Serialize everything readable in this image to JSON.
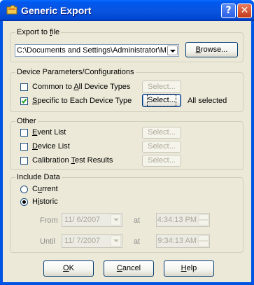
{
  "window": {
    "title": "Generic Export",
    "help_glyph": "?",
    "close_glyph": "✕",
    "title_icon": "folder-export-icon"
  },
  "export_to_file": {
    "group_title_pre": "Export to ",
    "group_title_u": "f",
    "group_title_post": "ile",
    "path_value": "C:\\Documents and Settings\\Administrator\\M",
    "browse_pre": "",
    "browse_u": "B",
    "browse_post": "rowse..."
  },
  "device_params": {
    "group_title": "Device Parameters/Configurations",
    "common": {
      "label_pre": "Common to ",
      "label_u": "A",
      "label_post": "ll Device Types",
      "checked": false,
      "select_label": "Select..."
    },
    "specific": {
      "label_pre": "",
      "label_u": "S",
      "label_post": "pecific to Each Device Type",
      "checked": true,
      "select_label": "Select...",
      "status": "All selected"
    }
  },
  "other": {
    "group_title": "Other",
    "items": [
      {
        "label_pre": "",
        "label_u": "E",
        "label_post": "vent List",
        "checked": false,
        "select_label": "Select..."
      },
      {
        "label_pre": "",
        "label_u": "D",
        "label_post": "evice List",
        "checked": false,
        "select_label": "Select..."
      },
      {
        "label_pre": "Calibration ",
        "label_u": "T",
        "label_post": "est Results",
        "checked": false,
        "select_label": "Select..."
      }
    ]
  },
  "include_data": {
    "group_title": "Include Data",
    "current": {
      "label_pre": "C",
      "label_u": "u",
      "label_post": "rrent",
      "selected": false
    },
    "historic": {
      "label_pre": "H",
      "label_u": "i",
      "label_post": "storic",
      "selected": true
    },
    "from": {
      "label": "From",
      "date": "11/ 6/2007",
      "at": "at",
      "time": "4:34:13 PM"
    },
    "until": {
      "label": "Until",
      "date": "11/ 7/2007",
      "at": "at",
      "time": "9:34:13 AM"
    }
  },
  "buttons": {
    "ok": {
      "pre": "",
      "u": "O",
      "post": "K"
    },
    "cancel": {
      "pre": "",
      "u": "C",
      "post": "ancel"
    },
    "help": {
      "pre": "",
      "u": "H",
      "post": "elp"
    }
  },
  "colors": {
    "title_bar": "#0054e3",
    "dialog_bg": "#ece9d8",
    "check_green": "#21a121"
  }
}
